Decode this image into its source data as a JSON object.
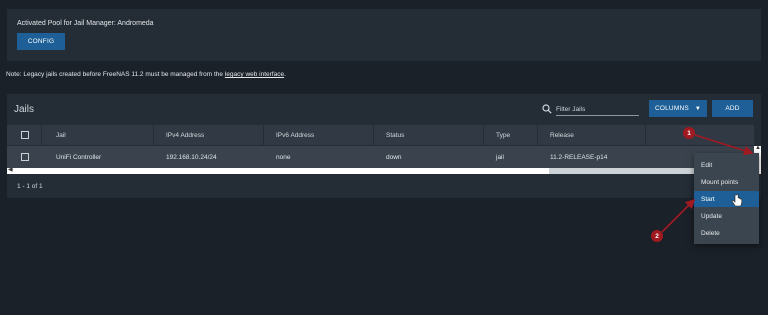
{
  "pool": {
    "text": "Activated Pool for Jail Manager: Andromeda",
    "config_label": "CONFIG"
  },
  "note": {
    "prefix": "Note: Legacy jails created before FreeNAS 11.2 must be managed from the",
    "link": "legacy web interface",
    "suffix": "."
  },
  "jails": {
    "title": "Jails",
    "search_placeholder": "Filter Jails",
    "columns_label": "COLUMNS",
    "add_label": "ADD",
    "headers": [
      "Jail",
      "IPv4 Address",
      "IPv6 Address",
      "Status",
      "Type",
      "Release"
    ],
    "rows": [
      {
        "jail": "UniFi Controller",
        "ipv4": "192.168.10.24/24",
        "ipv6": "none",
        "status": "down",
        "type": "jail",
        "release": "11.2-RELEASE-p14"
      }
    ],
    "paging": "1 - 1 of 1"
  },
  "menu": {
    "items": [
      "Edit",
      "Mount points",
      "Start",
      "Update",
      "Delete"
    ],
    "active_index": 2
  },
  "annotations": {
    "badges": [
      "1",
      "2"
    ],
    "color": "#a11a22"
  },
  "icons": {
    "search": "search-icon",
    "caret": "chevron-down-icon",
    "cursor": "hand-pointer-icon"
  }
}
